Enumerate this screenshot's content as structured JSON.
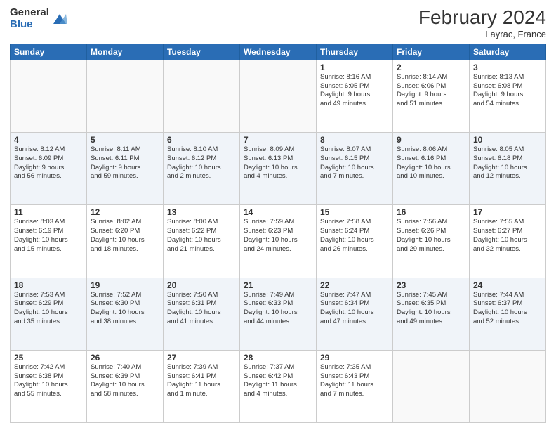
{
  "header": {
    "logo_general": "General",
    "logo_blue": "Blue",
    "month_title": "February 2024",
    "location": "Layrac, France"
  },
  "columns": [
    "Sunday",
    "Monday",
    "Tuesday",
    "Wednesday",
    "Thursday",
    "Friday",
    "Saturday"
  ],
  "weeks": [
    [
      {
        "day": "",
        "info": ""
      },
      {
        "day": "",
        "info": ""
      },
      {
        "day": "",
        "info": ""
      },
      {
        "day": "",
        "info": ""
      },
      {
        "day": "1",
        "info": "Sunrise: 8:16 AM\nSunset: 6:05 PM\nDaylight: 9 hours\nand 49 minutes."
      },
      {
        "day": "2",
        "info": "Sunrise: 8:14 AM\nSunset: 6:06 PM\nDaylight: 9 hours\nand 51 minutes."
      },
      {
        "day": "3",
        "info": "Sunrise: 8:13 AM\nSunset: 6:08 PM\nDaylight: 9 hours\nand 54 minutes."
      }
    ],
    [
      {
        "day": "4",
        "info": "Sunrise: 8:12 AM\nSunset: 6:09 PM\nDaylight: 9 hours\nand 56 minutes."
      },
      {
        "day": "5",
        "info": "Sunrise: 8:11 AM\nSunset: 6:11 PM\nDaylight: 9 hours\nand 59 minutes."
      },
      {
        "day": "6",
        "info": "Sunrise: 8:10 AM\nSunset: 6:12 PM\nDaylight: 10 hours\nand 2 minutes."
      },
      {
        "day": "7",
        "info": "Sunrise: 8:09 AM\nSunset: 6:13 PM\nDaylight: 10 hours\nand 4 minutes."
      },
      {
        "day": "8",
        "info": "Sunrise: 8:07 AM\nSunset: 6:15 PM\nDaylight: 10 hours\nand 7 minutes."
      },
      {
        "day": "9",
        "info": "Sunrise: 8:06 AM\nSunset: 6:16 PM\nDaylight: 10 hours\nand 10 minutes."
      },
      {
        "day": "10",
        "info": "Sunrise: 8:05 AM\nSunset: 6:18 PM\nDaylight: 10 hours\nand 12 minutes."
      }
    ],
    [
      {
        "day": "11",
        "info": "Sunrise: 8:03 AM\nSunset: 6:19 PM\nDaylight: 10 hours\nand 15 minutes."
      },
      {
        "day": "12",
        "info": "Sunrise: 8:02 AM\nSunset: 6:20 PM\nDaylight: 10 hours\nand 18 minutes."
      },
      {
        "day": "13",
        "info": "Sunrise: 8:00 AM\nSunset: 6:22 PM\nDaylight: 10 hours\nand 21 minutes."
      },
      {
        "day": "14",
        "info": "Sunrise: 7:59 AM\nSunset: 6:23 PM\nDaylight: 10 hours\nand 24 minutes."
      },
      {
        "day": "15",
        "info": "Sunrise: 7:58 AM\nSunset: 6:24 PM\nDaylight: 10 hours\nand 26 minutes."
      },
      {
        "day": "16",
        "info": "Sunrise: 7:56 AM\nSunset: 6:26 PM\nDaylight: 10 hours\nand 29 minutes."
      },
      {
        "day": "17",
        "info": "Sunrise: 7:55 AM\nSunset: 6:27 PM\nDaylight: 10 hours\nand 32 minutes."
      }
    ],
    [
      {
        "day": "18",
        "info": "Sunrise: 7:53 AM\nSunset: 6:29 PM\nDaylight: 10 hours\nand 35 minutes."
      },
      {
        "day": "19",
        "info": "Sunrise: 7:52 AM\nSunset: 6:30 PM\nDaylight: 10 hours\nand 38 minutes."
      },
      {
        "day": "20",
        "info": "Sunrise: 7:50 AM\nSunset: 6:31 PM\nDaylight: 10 hours\nand 41 minutes."
      },
      {
        "day": "21",
        "info": "Sunrise: 7:49 AM\nSunset: 6:33 PM\nDaylight: 10 hours\nand 44 minutes."
      },
      {
        "day": "22",
        "info": "Sunrise: 7:47 AM\nSunset: 6:34 PM\nDaylight: 10 hours\nand 47 minutes."
      },
      {
        "day": "23",
        "info": "Sunrise: 7:45 AM\nSunset: 6:35 PM\nDaylight: 10 hours\nand 49 minutes."
      },
      {
        "day": "24",
        "info": "Sunrise: 7:44 AM\nSunset: 6:37 PM\nDaylight: 10 hours\nand 52 minutes."
      }
    ],
    [
      {
        "day": "25",
        "info": "Sunrise: 7:42 AM\nSunset: 6:38 PM\nDaylight: 10 hours\nand 55 minutes."
      },
      {
        "day": "26",
        "info": "Sunrise: 7:40 AM\nSunset: 6:39 PM\nDaylight: 10 hours\nand 58 minutes."
      },
      {
        "day": "27",
        "info": "Sunrise: 7:39 AM\nSunset: 6:41 PM\nDaylight: 11 hours\nand 1 minute."
      },
      {
        "day": "28",
        "info": "Sunrise: 7:37 AM\nSunset: 6:42 PM\nDaylight: 11 hours\nand 4 minutes."
      },
      {
        "day": "29",
        "info": "Sunrise: 7:35 AM\nSunset: 6:43 PM\nDaylight: 11 hours\nand 7 minutes."
      },
      {
        "day": "",
        "info": ""
      },
      {
        "day": "",
        "info": ""
      }
    ]
  ]
}
